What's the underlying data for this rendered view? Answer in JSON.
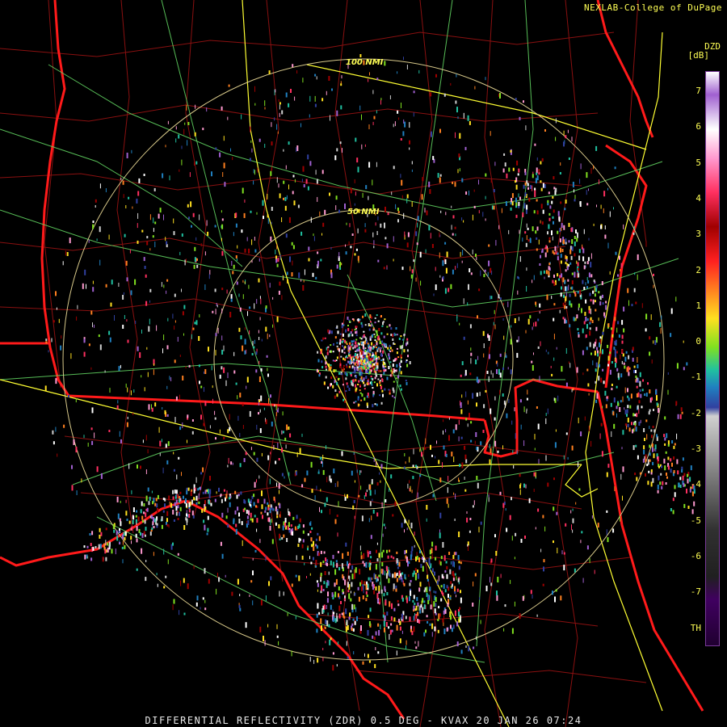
{
  "header": {
    "credit": "NEXLAB-College of DuPage"
  },
  "legend": {
    "product": "DZD",
    "units": "[dB]",
    "ticks": [
      "7",
      "6",
      "5",
      "4",
      "3",
      "2",
      "1",
      "0",
      "-1",
      "-2",
      "-3",
      "-4",
      "-5",
      "-6",
      "-7",
      "TH"
    ]
  },
  "rings": [
    {
      "label": "100 NMI",
      "range_nmi": 100
    },
    {
      "label": "50 NMI",
      "range_nmi": 50
    }
  ],
  "footer": {
    "title": "DIFFERENTIAL REFLECTIVITY (ZDR) 0.5 DEG - KVAX 20 JAN 26 07:24"
  },
  "colors": {
    "state_border": "#ff1a1a",
    "county_line": "#a01010",
    "interstate": "#ffff33",
    "highway": "#66dd66",
    "ring": "#d8c98a",
    "text": "#ffff55"
  }
}
